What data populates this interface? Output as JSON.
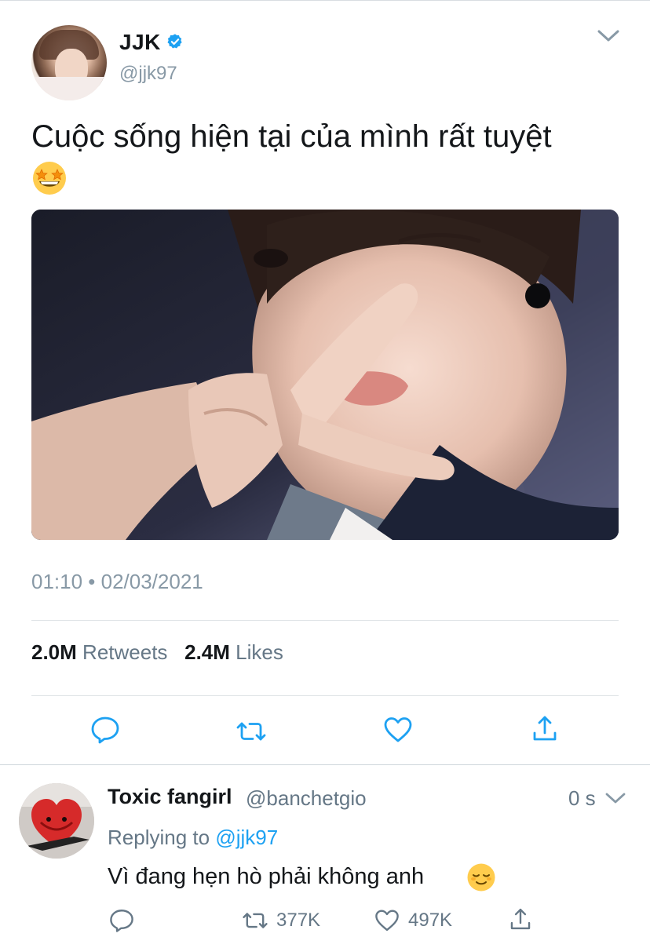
{
  "tweet": {
    "display_name": "JJK",
    "handle": "@jjk97",
    "text": "Cuộc sống hiện tại của mình rất tuyệt",
    "emoji": "star-struck",
    "timestamp": "01:10 • 02/03/2021",
    "retweets_count": "2.0M",
    "retweets_label": "Retweets",
    "likes_count": "2.4M",
    "likes_label": "Likes"
  },
  "reply": {
    "display_name": "Toxic fangirl",
    "handle": "@banchetgio",
    "time": "0 s",
    "replying_prefix": "Replying to",
    "replying_to": "@jjk97",
    "text": "Vì đang hẹn hò phải không anh",
    "emoji": "relieved-face",
    "retweets": "377K",
    "likes": "497K"
  },
  "colors": {
    "accent": "#1da1f2",
    "secondary_text": "#657786",
    "icon": "#1da1f2"
  }
}
